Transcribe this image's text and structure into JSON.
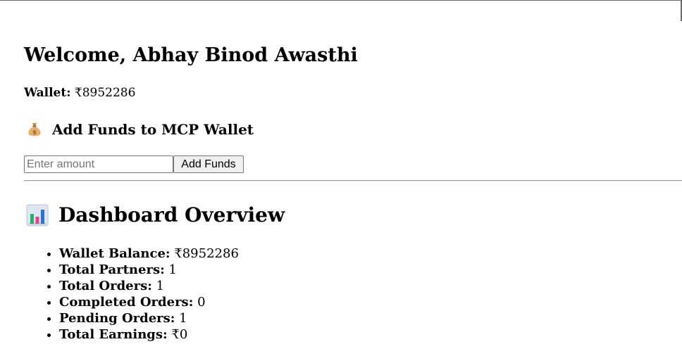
{
  "header": {
    "welcome": "Welcome, Abhay Binod Awasthi"
  },
  "wallet": {
    "label": "Wallet:",
    "value": "₹8952286"
  },
  "add_funds": {
    "icon": "money-bag-icon",
    "title": "Add Funds to MCP Wallet",
    "input_placeholder": "Enter amount",
    "input_value": "",
    "button_label": "Add Funds"
  },
  "overview": {
    "icon": "bar-chart-icon",
    "title": "Dashboard Overview",
    "items": [
      {
        "label": "Wallet Balance:",
        "value": "₹8952286"
      },
      {
        "label": "Total Partners:",
        "value": "1"
      },
      {
        "label": "Total Orders:",
        "value": "1"
      },
      {
        "label": "Completed Orders:",
        "value": "0"
      },
      {
        "label": "Pending Orders:",
        "value": "1"
      },
      {
        "label": "Total Earnings:",
        "value": "₹0"
      }
    ]
  }
}
